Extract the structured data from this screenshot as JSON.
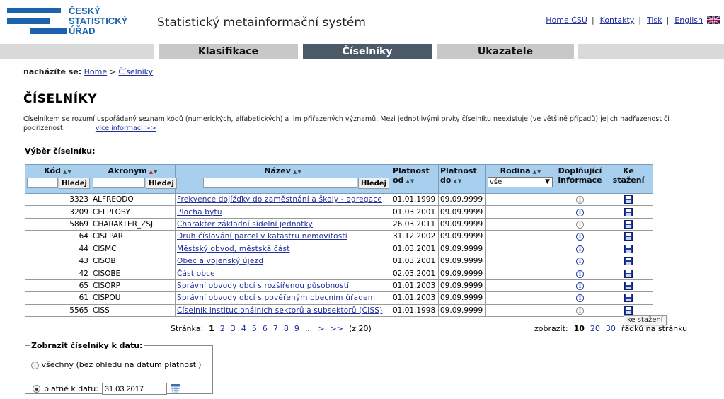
{
  "logo": {
    "line1": "ČESKÝ",
    "line2": "STATISTICKÝ",
    "line3": "ÚŘAD"
  },
  "site_title": "Statistický metainformační systém",
  "toplinks": [
    "Home ČSÚ",
    "Kontakty",
    "Tisk",
    "English"
  ],
  "nav": {
    "tabs": [
      "Klasifikace",
      "Číselníky",
      "Ukazatele"
    ],
    "active": "Číselníky"
  },
  "breadcrumb": {
    "prefix": "nacházíte se:",
    "home": "Home",
    "sep": ">",
    "current": "Číselníky"
  },
  "page_title": "ČÍSELNÍKY",
  "description": {
    "text": "Číselníkem se rozumí uspořádaný seznam kódů (numerických, alfabetických) a jim přiřazených významů. Mezi jednotlivými prvky číselníku neexistuje (ve většině případů) jejich nadřazenost či podřízenost.",
    "more_link": "více informací >>"
  },
  "select_label": "Výběr číselníku:",
  "table": {
    "headers": {
      "kod": "Kód",
      "akronym": "Akronym",
      "nazev": "Název",
      "platnost_od": "Platnost od",
      "platnost_do": "Platnost do",
      "rodina": "Rodina",
      "doplnujici": "Doplňující informace",
      "ke_stazeni": "Ke stažení"
    },
    "filter_button": "Hledej",
    "rodina_value": "vše",
    "rows": [
      {
        "kod": "3323",
        "akronym": "ALFREQDO",
        "nazev": "Frekvence dojížďky do zaměstnání a školy - agregace",
        "od": "01.01.1999",
        "do": "09.09.9999",
        "info": "grey"
      },
      {
        "kod": "3209",
        "akronym": "CELPLOBY",
        "nazev": "Plocha bytu",
        "od": "01.03.2001",
        "do": "09.09.9999",
        "info": "blue"
      },
      {
        "kod": "5869",
        "akronym": "CHARAKTER_ZSJ",
        "nazev": "Charakter základní sídelní jednotky",
        "od": "26.03.2011",
        "do": "09.09.9999",
        "info": "grey"
      },
      {
        "kod": "64",
        "akronym": "CISLPAR",
        "nazev": "Druh číslování parcel v katastru nemovitostí",
        "od": "31.12.2002",
        "do": "09.09.9999",
        "info": "blue"
      },
      {
        "kod": "44",
        "akronym": "CISMC",
        "nazev": "Městský obvod, městská část",
        "od": "01.03.2001",
        "do": "09.09.9999",
        "info": "blue"
      },
      {
        "kod": "43",
        "akronym": "CISOB",
        "nazev": "Obec a vojenský újezd",
        "od": "01.03.2001",
        "do": "09.09.9999",
        "info": "blue"
      },
      {
        "kod": "42",
        "akronym": "CISOBE",
        "nazev": "Část obce",
        "od": "02.03.2001",
        "do": "09.09.9999",
        "info": "blue"
      },
      {
        "kod": "65",
        "akronym": "CISORP",
        "nazev": "Správní obvody obcí s rozšířenou působností",
        "od": "01.01.2003",
        "do": "09.09.9999",
        "info": "blue"
      },
      {
        "kod": "61",
        "akronym": "CISPOU",
        "nazev": "Správní obvody obcí s pověřeným obecním úřadem",
        "od": "01.01.2003",
        "do": "09.09.9999",
        "info": "blue"
      },
      {
        "kod": "5565",
        "akronym": "CISS",
        "nazev": "Číselník institucionálních sektorů a subsektorů (ČISS)",
        "od": "01.01.1998",
        "do": "09.09.9999",
        "info": "grey"
      }
    ]
  },
  "pager": {
    "label": "Stránka:",
    "current": "1",
    "pages": [
      "2",
      "3",
      "4",
      "5",
      "6",
      "7",
      "8",
      "9"
    ],
    "ellipsis": "...",
    "next": ">",
    "last": ">>",
    "total": "(z 20)"
  },
  "per_page": {
    "label": "zobrazit:",
    "options": [
      "10",
      "20",
      "30"
    ],
    "current": "10",
    "suffix": "řádků na stránku"
  },
  "tooltip": "ke stažení",
  "date_filter": {
    "legend": "Zobrazit číselníky k datu:",
    "option_all": "všechny (bez ohledu na datum platnosti)",
    "option_valid": "platné k datu:",
    "date_value": "31.03.2017"
  },
  "colors": {
    "brand": "#1b63ad",
    "active_tab": "#4c5966",
    "table_header": "#a9cfee",
    "link": "#1f2f99"
  }
}
